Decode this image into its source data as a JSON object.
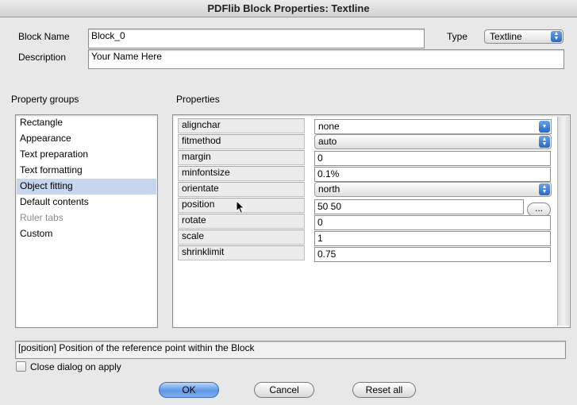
{
  "window": {
    "title": "PDFlib Block Properties: Textline"
  },
  "header": {
    "block_name_label": "Block Name",
    "block_name_value": "Block_0",
    "type_label": "Type",
    "type_value": "Textline",
    "description_label": "Description",
    "description_value": "Your Name Here"
  },
  "groups": {
    "heading": "Property groups",
    "items": [
      {
        "label": "Rectangle",
        "state": "normal"
      },
      {
        "label": "Appearance",
        "state": "normal"
      },
      {
        "label": "Text preparation",
        "state": "normal"
      },
      {
        "label": "Text formatting",
        "state": "normal"
      },
      {
        "label": "Object fitting",
        "state": "selected"
      },
      {
        "label": "Default contents",
        "state": "normal"
      },
      {
        "label": "Ruler tabs",
        "state": "disabled"
      },
      {
        "label": "Custom",
        "state": "normal"
      }
    ]
  },
  "properties": {
    "heading": "Properties",
    "rows": [
      {
        "name": "alignchar",
        "value": "none",
        "kind": "select"
      },
      {
        "name": "fitmethod",
        "value": "auto",
        "kind": "select"
      },
      {
        "name": "margin",
        "value": "0",
        "kind": "text"
      },
      {
        "name": "minfontsize",
        "value": "0.1%",
        "kind": "text"
      },
      {
        "name": "orientate",
        "value": "north",
        "kind": "select"
      },
      {
        "name": "position",
        "value": "50 50",
        "kind": "text",
        "has_button": true,
        "button_label": "..."
      },
      {
        "name": "rotate",
        "value": "0",
        "kind": "text"
      },
      {
        "name": "scale",
        "value": "1",
        "kind": "text"
      },
      {
        "name": "shrinklimit",
        "value": "0.75",
        "kind": "text"
      }
    ]
  },
  "status": {
    "help_text": "[position] Position of the reference point within the Block"
  },
  "options": {
    "close_on_apply_label": "Close dialog on apply",
    "close_on_apply_checked": false
  },
  "buttons": {
    "ok": "OK",
    "cancel": "Cancel",
    "reset": "Reset all"
  },
  "colors": {
    "accent": "#2a66c6",
    "selection": "#c5d6ee"
  }
}
